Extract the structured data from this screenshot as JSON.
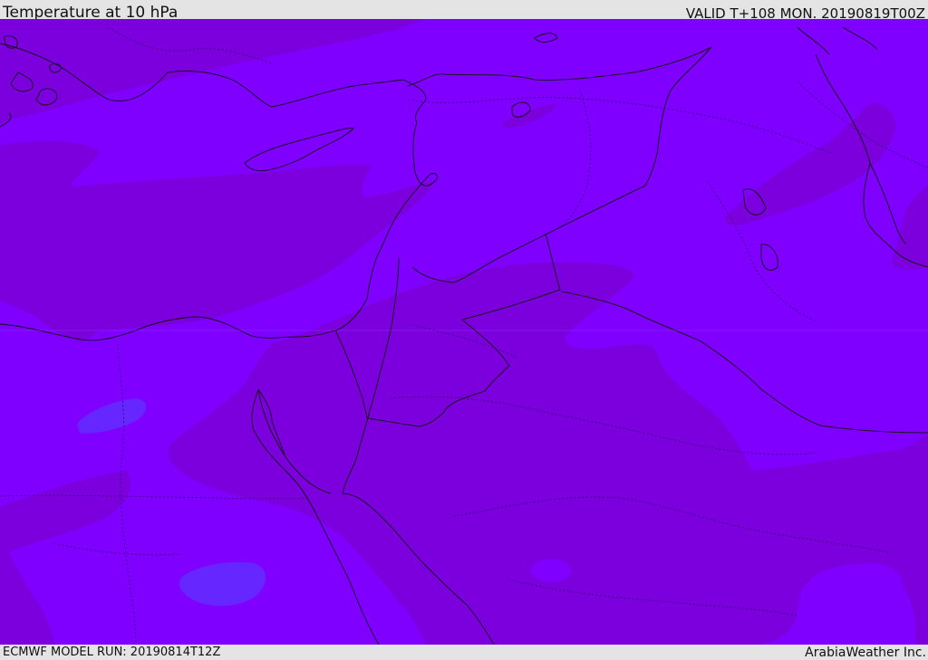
{
  "header": {
    "title": "Temperature at 10 hPa",
    "valid_time": "VALID T+108 MON. 20190819T00Z"
  },
  "footer": {
    "model_run": "ECMWF MODEL RUN: 20190814T12Z",
    "credit": "ArabiaWeather Inc."
  },
  "map": {
    "field": "Temperature",
    "level": "10 hPa",
    "colors": {
      "background": "#7f00ff",
      "warmer_band": "#7b00dd",
      "cooler_patch": "#6622ff",
      "borders": "#222222",
      "frame": "#e4e4e4"
    }
  }
}
